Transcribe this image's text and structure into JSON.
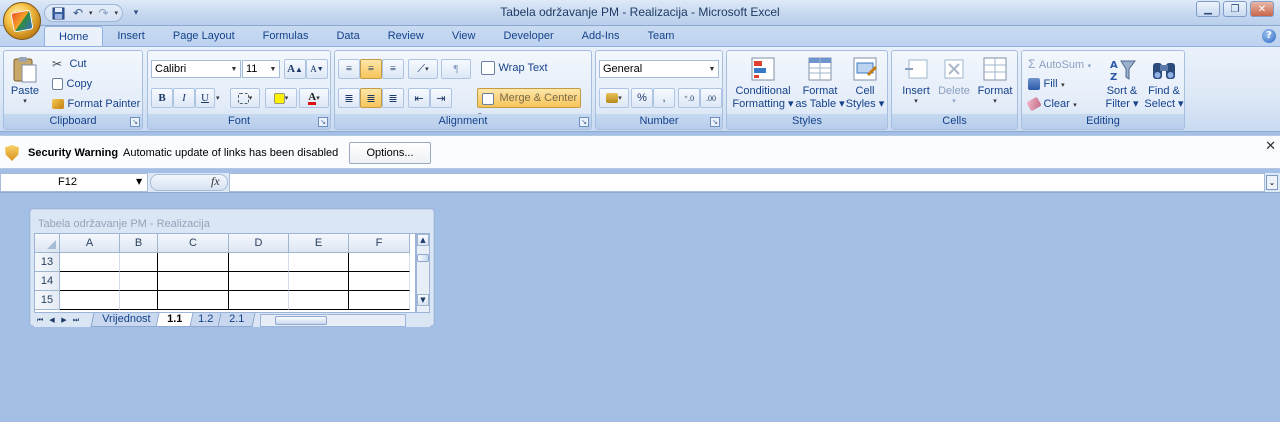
{
  "window": {
    "title": "Tabela održavanje PM - Realizacija - Microsoft Excel",
    "quick_access": [
      "save-icon",
      "undo-icon",
      "redo-icon",
      "customize-icon"
    ]
  },
  "tabs": [
    "Home",
    "Insert",
    "Page Layout",
    "Formulas",
    "Data",
    "Review",
    "View",
    "Developer",
    "Add-Ins",
    "Team"
  ],
  "active_tab": "Home",
  "ribbon": {
    "clipboard": {
      "label": "Clipboard",
      "paste": "Paste",
      "cut": "Cut",
      "copy": "Copy",
      "format_painter": "Format Painter"
    },
    "font": {
      "label": "Font",
      "name": "Calibri",
      "size": "11",
      "bold": "B",
      "italic": "I",
      "underline": "U"
    },
    "alignment": {
      "label": "Alignment",
      "wrap_text": "Wrap Text",
      "merge_center": "Merge & Center"
    },
    "number": {
      "label": "Number",
      "format": "General",
      "percent": "%",
      "comma": ","
    },
    "styles": {
      "label": "Styles",
      "conditional_1": "Conditional",
      "conditional_2": "Formatting",
      "format_table_1": "Format",
      "format_table_2": "as Table",
      "cell_styles_1": "Cell",
      "cell_styles_2": "Styles"
    },
    "cells": {
      "label": "Cells",
      "insert": "Insert",
      "delete": "Delete",
      "format": "Format"
    },
    "editing": {
      "label": "Editing",
      "autosum": "AutoSum",
      "fill": "Fill",
      "clear": "Clear",
      "sort_1": "Sort &",
      "sort_2": "Filter",
      "find_1": "Find &",
      "find_2": "Select"
    }
  },
  "security": {
    "title": "Security Warning",
    "message": "Automatic update of links has been disabled",
    "options": "Options..."
  },
  "formula_bar": {
    "name_box": "F12",
    "fx": "fx",
    "value": ""
  },
  "workbook": {
    "title": "Tabela održavanje PM - Realizacija",
    "columns": [
      "A",
      "B",
      "C",
      "D",
      "E",
      "F"
    ],
    "rows": [
      "13",
      "14",
      "15"
    ],
    "sheets": [
      "Vrijednost",
      "1.1",
      "1.2",
      "2.1"
    ],
    "active_sheet": "1.1"
  },
  "colors": {
    "accent": "#15428b",
    "background": "#a3bfe6",
    "ribbon": "#dde8f6"
  }
}
